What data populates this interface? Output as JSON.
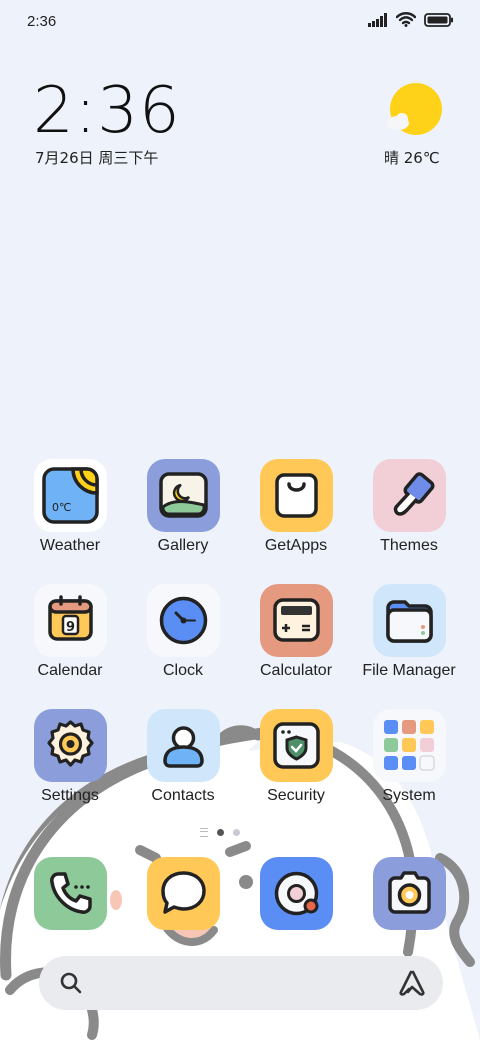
{
  "status_bar": {
    "time": "2:36",
    "icons": [
      "signal-icon",
      "wifi-icon",
      "battery-icon"
    ]
  },
  "clock_widget": {
    "time": "2:36",
    "date": "7月26日 周三下午"
  },
  "weather_widget": {
    "icon": "sun-cloud-icon",
    "text": "晴 26℃"
  },
  "apps": [
    {
      "label": "Weather",
      "icon": "weather-icon"
    },
    {
      "label": "Gallery",
      "icon": "gallery-icon"
    },
    {
      "label": "GetApps",
      "icon": "shopping-bag-icon"
    },
    {
      "label": "Themes",
      "icon": "paintbrush-icon"
    },
    {
      "label": "Calendar",
      "icon": "calendar-icon"
    },
    {
      "label": "Clock",
      "icon": "clock-icon"
    },
    {
      "label": "Calculator",
      "icon": "calculator-icon"
    },
    {
      "label": "File Manager",
      "icon": "folder-icon"
    },
    {
      "label": "Settings",
      "icon": "gear-icon"
    },
    {
      "label": "Contacts",
      "icon": "person-icon"
    },
    {
      "label": "Security",
      "icon": "shield-icon"
    },
    {
      "label": "System",
      "icon": "folder-grid-icon"
    }
  ],
  "weather_icon_text": "0℃",
  "calendar_icon_text": "9",
  "dock": [
    {
      "name": "Phone",
      "icon": "phone-icon"
    },
    {
      "name": "Messages",
      "icon": "message-icon"
    },
    {
      "name": "Browser",
      "icon": "browser-icon"
    },
    {
      "name": "Camera",
      "icon": "camera-icon"
    }
  ],
  "search_bar": {
    "left_icon": "search-icon",
    "right_icon": "assistant-icon"
  },
  "colors": {
    "background": "#eef3fb",
    "weather_tile": "#ffffff",
    "gallery_tile": "#8b9edb",
    "getapps_tile": "#ffc857",
    "themes_tile": "#f2cfd6",
    "calendar_tile": "#f6f8fb",
    "clock_tile": "#f6f8fb",
    "calculator_tile": "#e59a7f",
    "filemanager_tile": "#cfe6fb",
    "settings_tile": "#8b9edb",
    "contacts_tile": "#cfe6fb",
    "security_tile": "#ffc857",
    "system_tile": "#f6f8fb",
    "phone_tile": "#8ec99a",
    "messages_tile": "#ffc857",
    "browser_tile": "#5b8ef5",
    "camera_tile": "#8b9edb"
  }
}
